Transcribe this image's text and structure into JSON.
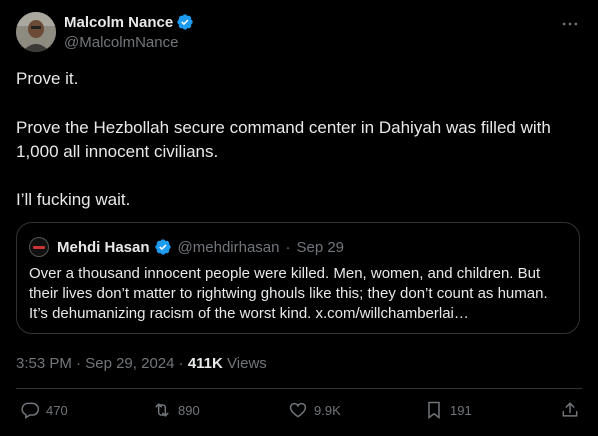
{
  "author": {
    "name": "Malcolm Nance",
    "handle": "@MalcolmNance",
    "verified": true
  },
  "tweet": {
    "paragraphs": [
      "Prove it.",
      "Prove the Hezbollah secure command center in Dahiyah was filled with 1,000 all innocent civilians.",
      "I’ll fucking wait."
    ]
  },
  "quoted": {
    "name": "Mehdi Hasan",
    "handle": "@mehdirhasan",
    "separator": "·",
    "date": "Sep 29",
    "text": "Over a thousand innocent people were killed. Men, women, and children. But their lives don’t matter to rightwing ghouls like this; they don’t count as human. It’s dehumanizing racism of the worst kind. x.com/willchamberlai…"
  },
  "meta": {
    "time": "3:53 PM",
    "sep1": "·",
    "date": "Sep 29, 2024",
    "sep2": "·",
    "views_count": "411K",
    "views_label": "Views"
  },
  "actions": {
    "replies": "470",
    "reposts": "890",
    "likes": "9.9K",
    "bookmarks": "191"
  },
  "colors": {
    "background": "#000000",
    "text": "#e7e9ea",
    "secondary": "#71767b",
    "verified": "#1d9bf0",
    "border": "#2f3336"
  },
  "icons": [
    "verified-badge-icon",
    "more-icon",
    "reply-icon",
    "repost-icon",
    "like-icon",
    "bookmark-icon",
    "share-icon"
  ]
}
